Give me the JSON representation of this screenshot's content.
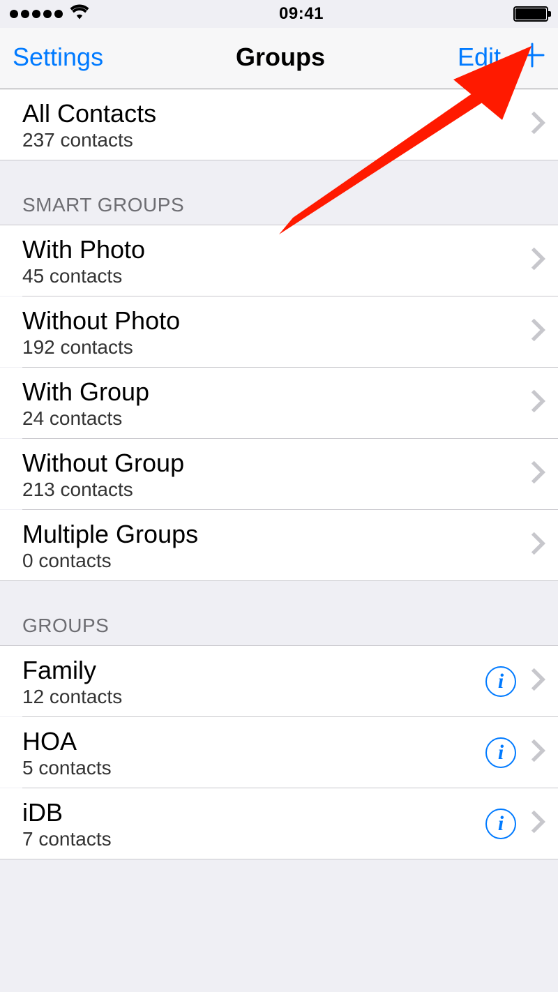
{
  "status": {
    "time": "09:41"
  },
  "nav": {
    "back": "Settings",
    "title": "Groups",
    "edit": "Edit"
  },
  "all": {
    "title": "All Contacts",
    "sub": "237 contacts"
  },
  "sections": {
    "smart": {
      "header": "SMART GROUPS",
      "items": [
        {
          "title": "With Photo",
          "sub": "45 contacts"
        },
        {
          "title": "Without Photo",
          "sub": "192 contacts"
        },
        {
          "title": "With Group",
          "sub": "24 contacts"
        },
        {
          "title": "Without Group",
          "sub": "213 contacts"
        },
        {
          "title": "Multiple Groups",
          "sub": "0 contacts"
        }
      ]
    },
    "groups": {
      "header": "GROUPS",
      "items": [
        {
          "title": "Family",
          "sub": "12 contacts"
        },
        {
          "title": "HOA",
          "sub": "5 contacts"
        },
        {
          "title": "iDB",
          "sub": "7 contacts"
        }
      ]
    }
  }
}
